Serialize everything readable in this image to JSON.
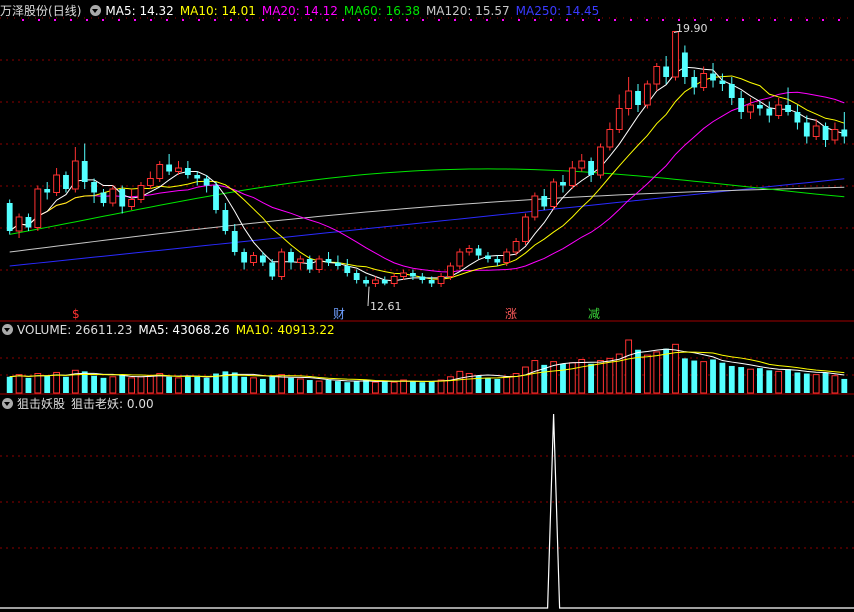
{
  "stock": {
    "name": "万泽股份",
    "period": "(日线)"
  },
  "colors": {
    "up": "#ff3232",
    "down": "#54ffff",
    "grid": "#8b0000",
    "border": "#a00000",
    "ma5": "#ffffff",
    "ma10": "#ffff00",
    "ma20": "#ff00ff",
    "ma60": "#00e600",
    "ma120": "#c8c8c8",
    "ma250": "#2a2aff"
  },
  "legend": {
    "ma5": "MA5: 14.32",
    "ma10": "MA10: 14.01",
    "ma20": "MA20: 14.12",
    "ma60": "MA60: 16.38",
    "ma120": "MA120: 15.57",
    "ma250": "MA250: 14.45"
  },
  "annotations": {
    "high": "19.90",
    "low": "12.61"
  },
  "markers": {
    "m1": "$",
    "m2": "财",
    "m3": "涨",
    "m4": "减"
  },
  "volume_panel": {
    "label": "VOLUME: 26611.23",
    "ma5": "MA5: 43068.26",
    "ma10": "MA10: 40913.22"
  },
  "indicator_panel": {
    "name": "狙击妖股",
    "label": "狙击老妖: 0.00"
  },
  "chart_data": {
    "type": "candlestick",
    "price_range": [
      12.0,
      20.0
    ],
    "candles": [
      [
        15.0,
        14.2,
        15.1,
        14.1
      ],
      [
        14.2,
        14.6,
        14.7,
        14.0
      ],
      [
        14.6,
        14.3,
        14.7,
        14.2
      ],
      [
        14.3,
        15.4,
        15.5,
        14.2
      ],
      [
        15.4,
        15.3,
        15.6,
        15.1
      ],
      [
        15.3,
        15.8,
        16.0,
        15.2
      ],
      [
        15.8,
        15.4,
        15.9,
        15.3
      ],
      [
        15.4,
        16.2,
        16.6,
        15.3
      ],
      [
        16.2,
        15.6,
        16.7,
        15.4
      ],
      [
        15.6,
        15.3,
        15.7,
        15.0
      ],
      [
        15.3,
        15.0,
        15.4,
        14.9
      ],
      [
        15.0,
        15.4,
        15.5,
        14.9
      ],
      [
        15.4,
        14.9,
        15.5,
        14.7
      ],
      [
        14.9,
        15.1,
        15.4,
        14.8
      ],
      [
        15.1,
        15.5,
        15.6,
        15.0
      ],
      [
        15.5,
        15.7,
        15.9,
        15.4
      ],
      [
        15.7,
        16.1,
        16.2,
        15.6
      ],
      [
        16.1,
        15.9,
        16.4,
        15.8
      ],
      [
        15.9,
        16.0,
        16.2,
        15.8
      ],
      [
        16.0,
        15.8,
        16.2,
        15.7
      ],
      [
        15.8,
        15.7,
        15.9,
        15.5
      ],
      [
        15.7,
        15.5,
        15.8,
        15.3
      ],
      [
        15.5,
        14.8,
        15.6,
        14.7
      ],
      [
        14.8,
        14.2,
        15.0,
        14.1
      ],
      [
        14.2,
        13.6,
        14.4,
        13.5
      ],
      [
        13.6,
        13.3,
        13.7,
        13.1
      ],
      [
        13.3,
        13.5,
        13.6,
        13.2
      ],
      [
        13.5,
        13.3,
        13.6,
        13.2
      ],
      [
        13.3,
        12.9,
        13.4,
        12.8
      ],
      [
        12.9,
        13.6,
        13.7,
        12.8
      ],
      [
        13.6,
        13.3,
        13.7,
        13.1
      ],
      [
        13.3,
        13.4,
        13.5,
        13.1
      ],
      [
        13.4,
        13.1,
        13.5,
        13.0
      ],
      [
        13.1,
        13.4,
        13.5,
        13.0
      ],
      [
        13.4,
        13.3,
        13.6,
        13.2
      ],
      [
        13.3,
        13.2,
        13.5,
        13.1
      ],
      [
        13.2,
        13.0,
        13.4,
        12.9
      ],
      [
        13.0,
        12.8,
        13.1,
        12.7
      ],
      [
        12.8,
        12.7,
        12.9,
        12.61
      ],
      [
        12.7,
        12.8,
        12.9,
        12.6
      ],
      [
        12.8,
        12.7,
        12.9,
        12.65
      ],
      [
        12.7,
        12.9,
        13.0,
        12.6
      ],
      [
        12.9,
        13.0,
        13.1,
        12.8
      ],
      [
        13.0,
        12.9,
        13.1,
        12.8
      ],
      [
        12.9,
        12.8,
        13.0,
        12.7
      ],
      [
        12.8,
        12.7,
        12.9,
        12.6
      ],
      [
        12.7,
        12.9,
        13.0,
        12.6
      ],
      [
        12.9,
        13.2,
        13.3,
        12.8
      ],
      [
        13.2,
        13.6,
        13.7,
        13.1
      ],
      [
        13.6,
        13.7,
        13.8,
        13.5
      ],
      [
        13.7,
        13.5,
        13.8,
        13.4
      ],
      [
        13.5,
        13.4,
        13.6,
        13.3
      ],
      [
        13.4,
        13.3,
        13.5,
        13.2
      ],
      [
        13.3,
        13.6,
        13.7,
        13.2
      ],
      [
        13.6,
        13.9,
        14.0,
        13.5
      ],
      [
        13.9,
        14.6,
        14.7,
        13.8
      ],
      [
        14.6,
        15.2,
        15.3,
        14.5
      ],
      [
        15.2,
        14.9,
        15.4,
        14.8
      ],
      [
        14.9,
        15.6,
        15.7,
        14.8
      ],
      [
        15.6,
        15.5,
        15.8,
        15.3
      ],
      [
        15.5,
        16.0,
        16.2,
        15.4
      ],
      [
        16.0,
        16.2,
        16.4,
        15.9
      ],
      [
        16.2,
        15.8,
        16.3,
        15.6
      ],
      [
        15.8,
        16.6,
        16.7,
        15.7
      ],
      [
        16.6,
        17.1,
        17.3,
        16.5
      ],
      [
        17.1,
        17.7,
        18.1,
        17.0
      ],
      [
        17.7,
        18.2,
        18.6,
        17.5
      ],
      [
        18.2,
        17.8,
        18.4,
        17.6
      ],
      [
        17.8,
        18.4,
        18.5,
        17.7
      ],
      [
        18.4,
        18.9,
        19.0,
        18.2
      ],
      [
        18.9,
        18.6,
        19.2,
        18.4
      ],
      [
        18.6,
        19.9,
        19.9,
        18.5
      ],
      [
        19.3,
        18.6,
        19.5,
        18.4
      ],
      [
        18.6,
        18.3,
        18.8,
        18.1
      ],
      [
        18.3,
        18.7,
        18.9,
        18.2
      ],
      [
        18.7,
        18.5,
        19.0,
        18.3
      ],
      [
        18.5,
        18.4,
        18.7,
        18.2
      ],
      [
        18.4,
        18.0,
        18.6,
        17.8
      ],
      [
        18.0,
        17.6,
        18.2,
        17.4
      ],
      [
        17.6,
        17.8,
        18.0,
        17.4
      ],
      [
        17.8,
        17.7,
        17.9,
        17.5
      ],
      [
        17.7,
        17.5,
        17.9,
        17.3
      ],
      [
        17.5,
        17.8,
        18.0,
        17.4
      ],
      [
        17.8,
        17.6,
        18.3,
        17.5
      ],
      [
        17.6,
        17.3,
        17.8,
        17.1
      ],
      [
        17.3,
        16.9,
        17.5,
        16.7
      ],
      [
        16.9,
        17.2,
        17.4,
        16.8
      ],
      [
        17.2,
        16.8,
        17.3,
        16.6
      ],
      [
        16.8,
        17.1,
        17.3,
        16.7
      ],
      [
        17.1,
        16.9,
        17.6,
        16.7
      ]
    ],
    "volume": [
      30,
      34,
      28,
      36,
      32,
      38,
      30,
      42,
      40,
      32,
      28,
      30,
      34,
      28,
      30,
      32,
      36,
      30,
      28,
      32,
      30,
      28,
      36,
      40,
      38,
      30,
      28,
      26,
      30,
      34,
      28,
      26,
      24,
      22,
      24,
      22,
      20,
      22,
      24,
      20,
      22,
      20,
      24,
      22,
      20,
      22,
      24,
      30,
      40,
      36,
      32,
      28,
      26,
      30,
      36,
      48,
      60,
      52,
      58,
      54,
      56,
      62,
      54,
      60,
      64,
      72,
      98,
      80,
      70,
      76,
      82,
      90,
      64,
      60,
      58,
      62,
      56,
      50,
      48,
      44,
      46,
      42,
      40,
      44,
      38,
      36,
      34,
      38,
      32,
      26
    ],
    "indicator": {
      "spike_value": 1.0,
      "spike_index": 58,
      "baseline": 0.0
    }
  }
}
